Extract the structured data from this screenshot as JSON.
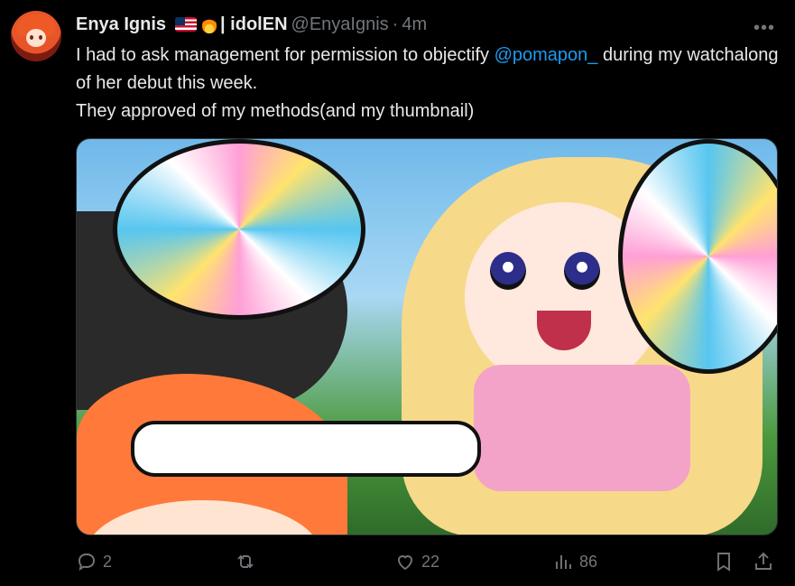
{
  "author": {
    "name": "Enya Ignis",
    "name_suffix": "| idolEN",
    "handle": "@EnyaIgnis",
    "separator": "·",
    "timestamp": "4m"
  },
  "menu": {
    "more_label": "•••"
  },
  "tweet": {
    "line1_before": "I had to ask management for permission to objectify ",
    "mention": "@pomapon_",
    "line1_after": " during my watchalong of her debut this week.",
    "line2": "They approved of my methods(and my thumbnail)"
  },
  "actions": {
    "reply_count": "2",
    "retweet_count": "",
    "like_count": "22",
    "views_count": "86"
  },
  "colors": {
    "background": "#000000",
    "text": "#e7e9ea",
    "muted": "#71767b",
    "link": "#1d9bf0"
  },
  "icons": [
    "reply-icon",
    "retweet-icon",
    "like-icon",
    "views-icon",
    "bookmark-icon",
    "share-icon",
    "more-icon",
    "flag-icon",
    "fire-icon"
  ]
}
